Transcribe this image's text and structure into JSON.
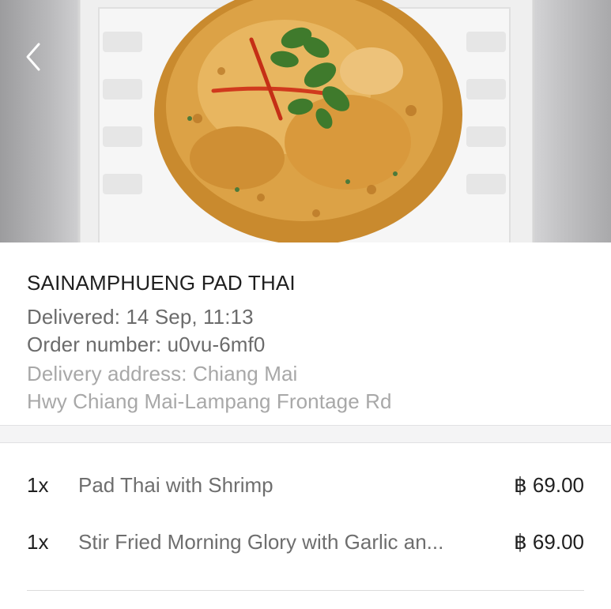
{
  "header": {
    "back_icon": "chevron-left-icon",
    "hero_image": "omelette-with-coriander-photo"
  },
  "order": {
    "restaurant": "SAINAMPHUENG PAD THAI",
    "delivered": "Delivered: 14 Sep, 11:13",
    "order_number": "Order number: u0vu-6mf0",
    "address_line1": "Delivery address: Chiang Mai",
    "address_line2": "Hwy Chiang Mai-Lampang Frontage Rd"
  },
  "items": [
    {
      "qty": "1x",
      "name": "Pad Thai with Shrimp",
      "price": "฿ 69.00"
    },
    {
      "qty": "1x",
      "name": "Stir Fried Morning Glory with Garlic an...",
      "price": "฿ 69.00"
    }
  ],
  "colors": {
    "title": "#1f1f1f",
    "secondary": "#6b6b6b",
    "muted": "#a8a8a8",
    "divider": "#f4f4f5"
  }
}
